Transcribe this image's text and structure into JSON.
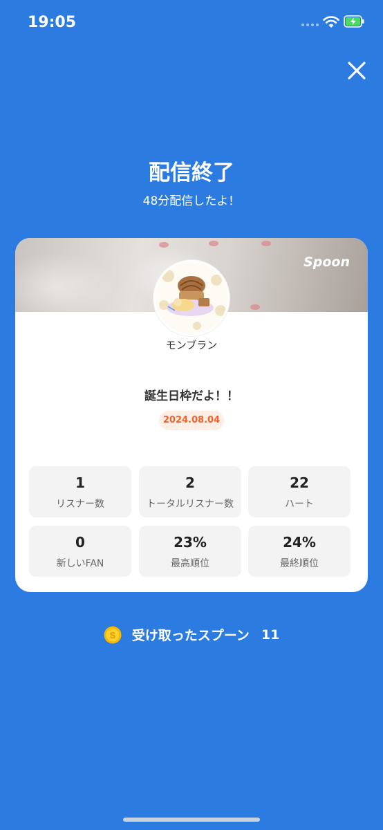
{
  "status_bar": {
    "time": "19:05",
    "icons": [
      "signal-icon",
      "wifi-icon",
      "battery-charging-icon"
    ]
  },
  "header": {
    "close_icon": "close-icon",
    "title": "配信終了",
    "subtitle": "48分配信したよ！"
  },
  "card": {
    "brand": "Spoon",
    "profile_name": "モンブラン",
    "broadcast_title": "誕生日枠だよ！！",
    "date": "2024.08.04",
    "stats": [
      {
        "value": "1",
        "label": "リスナー数"
      },
      {
        "value": "2",
        "label": "トータルリスナー数"
      },
      {
        "value": "22",
        "label": "ハート"
      },
      {
        "value": "0",
        "label": "新しいFAN"
      },
      {
        "value": "23%",
        "label": "最高順位"
      },
      {
        "value": "24%",
        "label": "最終順位"
      }
    ]
  },
  "spoons": {
    "icon": "coin-icon",
    "label": "受け取ったスプーン",
    "count": "11"
  },
  "colors": {
    "background": "#2b7be1",
    "card": "#ffffff",
    "date_text": "#f0612b",
    "date_badge": "#fdeee6",
    "coin": "#f5b800"
  }
}
